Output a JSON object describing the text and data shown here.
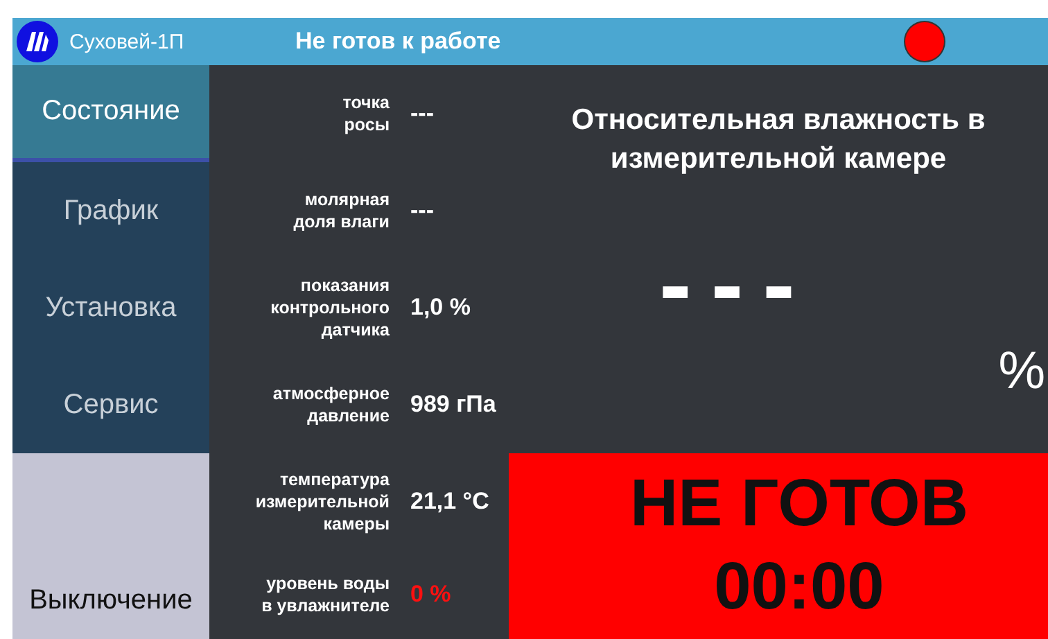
{
  "header": {
    "app_name": "Суховей-1П",
    "status": "Не готов к работе",
    "indicator": {
      "color": "#ff0000"
    }
  },
  "nav": [
    {
      "label": "Состояние",
      "selected": true
    },
    {
      "label": "График",
      "selected": false
    },
    {
      "label": "Установка",
      "selected": false
    },
    {
      "label": "Сервис",
      "selected": false
    }
  ],
  "power_button": "Выключение",
  "readings": [
    {
      "label_lines": [
        "точка",
        "росы"
      ],
      "value": "---",
      "alarm": false
    },
    {
      "label_lines": [
        "молярная",
        "доля влаги"
      ],
      "value": "---",
      "alarm": false
    },
    {
      "label_lines": [
        "показания",
        "контрольного",
        "датчика"
      ],
      "value": "1,0 %",
      "alarm": false
    },
    {
      "label_lines": [
        "атмосферное",
        "давление"
      ],
      "value": "989 гПа",
      "alarm": false
    },
    {
      "label_lines": [
        "температура",
        "измерительной",
        "камеры"
      ],
      "value": "21,1 °C",
      "alarm": false
    },
    {
      "label_lines": [
        "уровень воды",
        "в увлажнителе"
      ],
      "value": "0 %",
      "alarm": true
    }
  ],
  "main": {
    "title": "Относительная влажность в измерительной камере",
    "reading": "---",
    "unit": "%"
  },
  "state_panel": {
    "status": "НЕ ГОТОВ",
    "timer": "00:00",
    "color": "#ff0000"
  }
}
